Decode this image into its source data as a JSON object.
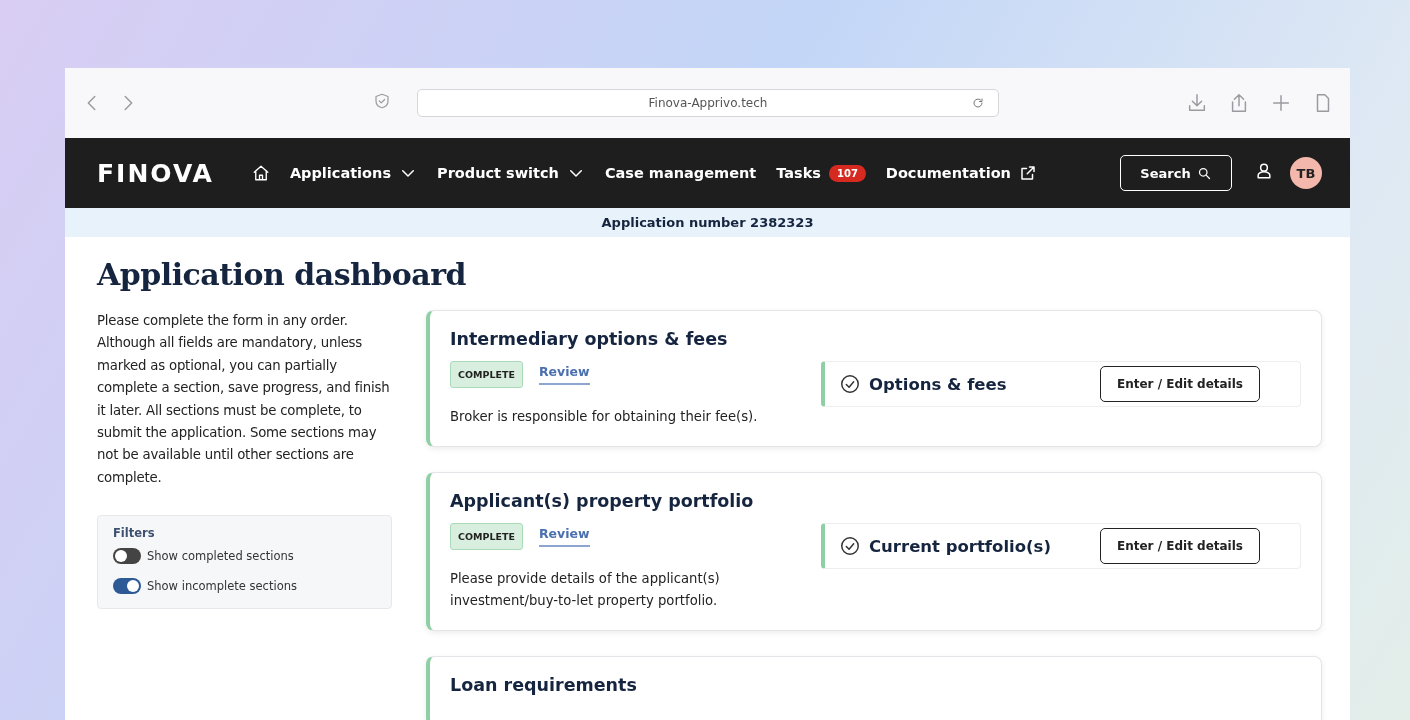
{
  "browser": {
    "url": "Finova-Apprivo.tech"
  },
  "nav": {
    "logo": "FINOVA",
    "items": [
      {
        "label": "Applications",
        "kind": "dropdown"
      },
      {
        "label": "Product switch",
        "kind": "dropdown"
      },
      {
        "label": "Case management",
        "kind": "plain"
      },
      {
        "label": "Tasks",
        "kind": "badge",
        "badge": "107"
      },
      {
        "label": "Documentation",
        "kind": "external"
      }
    ],
    "search": "Search",
    "avatar": "TB"
  },
  "application_bar": "Application number 2382323",
  "page_title": "Application dashboard",
  "intro": "Please complete the form in any order. Although all fields are mandatory, unless marked as optional, you can partially complete a section, save progress, and finish it later. All sections must be complete, to submit the application. Some sections may not be available until other sections are complete.",
  "filters": {
    "title": "Filters",
    "toggles": [
      {
        "label": "Show completed sections",
        "on": false
      },
      {
        "label": "Show incomplete sections",
        "on": true
      }
    ]
  },
  "sections": [
    {
      "title": "Intermediary options & fees",
      "status": "COMPLETE",
      "link": "Review",
      "description": "Broker is responsible for obtaining their fee(s).",
      "subsections": [
        {
          "title": "Options & fees",
          "button": "Enter / Edit details"
        }
      ]
    },
    {
      "title": "Applicant(s) property portfolio",
      "status": "COMPLETE",
      "link": "Review",
      "description": "Please provide details of the applicant(s) investment/buy-to-let property portfolio.",
      "subsections": [
        {
          "title": "Current portfolio(s)",
          "button": "Enter / Edit details"
        }
      ]
    },
    {
      "title": "Loan requirements"
    }
  ]
}
